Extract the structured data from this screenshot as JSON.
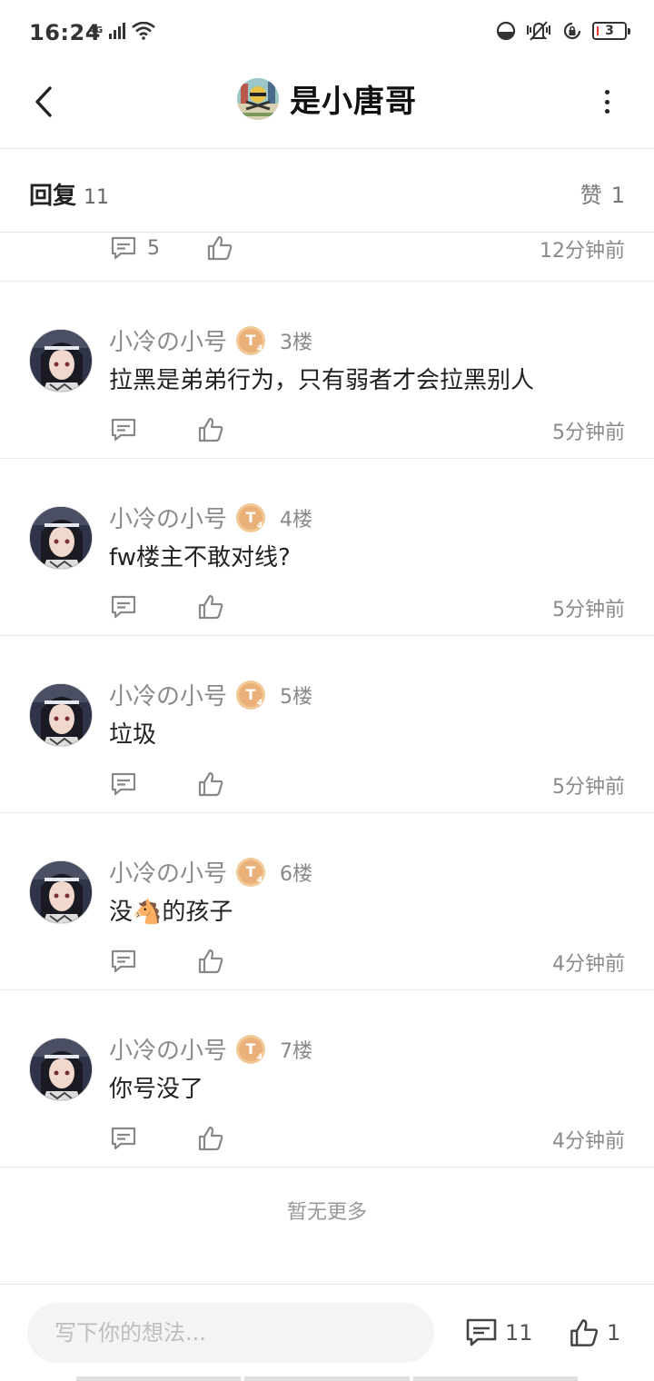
{
  "status_bar": {
    "time": "16:24",
    "network": "4G",
    "battery": "3"
  },
  "header": {
    "title": "是小唐哥",
    "back_icon": "chevron-left-icon",
    "more_icon": "more-vertical-icon"
  },
  "tabs": {
    "reply_label": "回复",
    "reply_count": "11",
    "like_label": "赞",
    "like_count": "1"
  },
  "partial_row": {
    "reply_count": "5",
    "time": "12分钟前"
  },
  "comments": [
    {
      "username": "小冷の小号",
      "level": "T",
      "level_sub": "4",
      "floor": "3楼",
      "content": "拉黑是弟弟行为，只有弱者才会拉黑别人",
      "time": "5分钟前"
    },
    {
      "username": "小冷の小号",
      "level": "T",
      "level_sub": "4",
      "floor": "4楼",
      "content": "fw楼主不敢对线?",
      "time": "5分钟前"
    },
    {
      "username": "小冷の小号",
      "level": "T",
      "level_sub": "4",
      "floor": "5楼",
      "content": "垃圾",
      "time": "5分钟前"
    },
    {
      "username": "小冷の小号",
      "level": "T",
      "level_sub": "4",
      "floor": "6楼",
      "content": "没🐴的孩子",
      "time": "4分钟前"
    },
    {
      "username": "小冷の小号",
      "level": "T",
      "level_sub": "4",
      "floor": "7楼",
      "content": "你号没了",
      "time": "4分钟前"
    }
  ],
  "end_text": "暂无更多",
  "bottom_bar": {
    "input_placeholder": "写下你的想法...",
    "reply_count": "11",
    "like_count": "1"
  }
}
